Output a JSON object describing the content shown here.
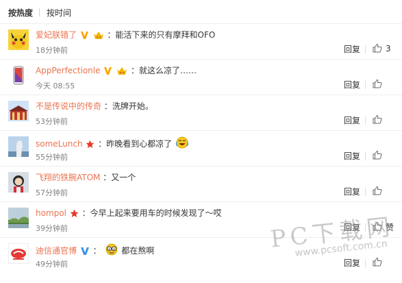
{
  "sort": {
    "hot_label": "按热度",
    "time_label": "按时间"
  },
  "reply_label": "回复",
  "like_label_text": "赞",
  "colors": {
    "username": "#eb7350",
    "text": "#333333",
    "time": "#808080",
    "vip": "#ffa500",
    "verified": "#3d93e6"
  },
  "comments": [
    {
      "username": "爱妃朕错了",
      "badges": [
        "vip-v-icon",
        "crown-emoji-icon"
      ],
      "text": "：能活下来的只有摩拜和OFO",
      "time": "18分钟前",
      "likes": "3"
    },
    {
      "username": "AppPerfectionle",
      "badges": [
        "vip-v-icon",
        "crown-emoji-icon"
      ],
      "text": "：就这么凉了……",
      "time": "今天 08:55",
      "likes": ""
    },
    {
      "username": "不是传说中的传奇",
      "badges": [],
      "text": "：洗牌开始。",
      "time": "53分钟前",
      "likes": ""
    },
    {
      "username": "someLunch",
      "badges": [
        "red-star-icon"
      ],
      "text": "：昨晚看到心都凉了",
      "emoji": "laughing-crying-emoji-icon",
      "time": "55分钟前",
      "likes": ""
    },
    {
      "username": "飞翔的铁腕ATOM",
      "badges": [],
      "text": "：又一个",
      "time": "57分钟前",
      "likes": ""
    },
    {
      "username": "hompol",
      "badges": [
        "red-star-icon"
      ],
      "text": "：今早上起来要用车的时候发现了～哎",
      "time": "39分钟前",
      "likes": "",
      "like_text": "赞"
    },
    {
      "username": "迪信通官博",
      "badges": [
        "verified-v-icon"
      ],
      "text": "都在熬啊",
      "emoji_before": "glasses-emoji-icon",
      "time": "49分钟前",
      "likes": ""
    }
  ],
  "watermark": {
    "main": "PC下载网",
    "url": "www.pcsoft.com.cn"
  }
}
